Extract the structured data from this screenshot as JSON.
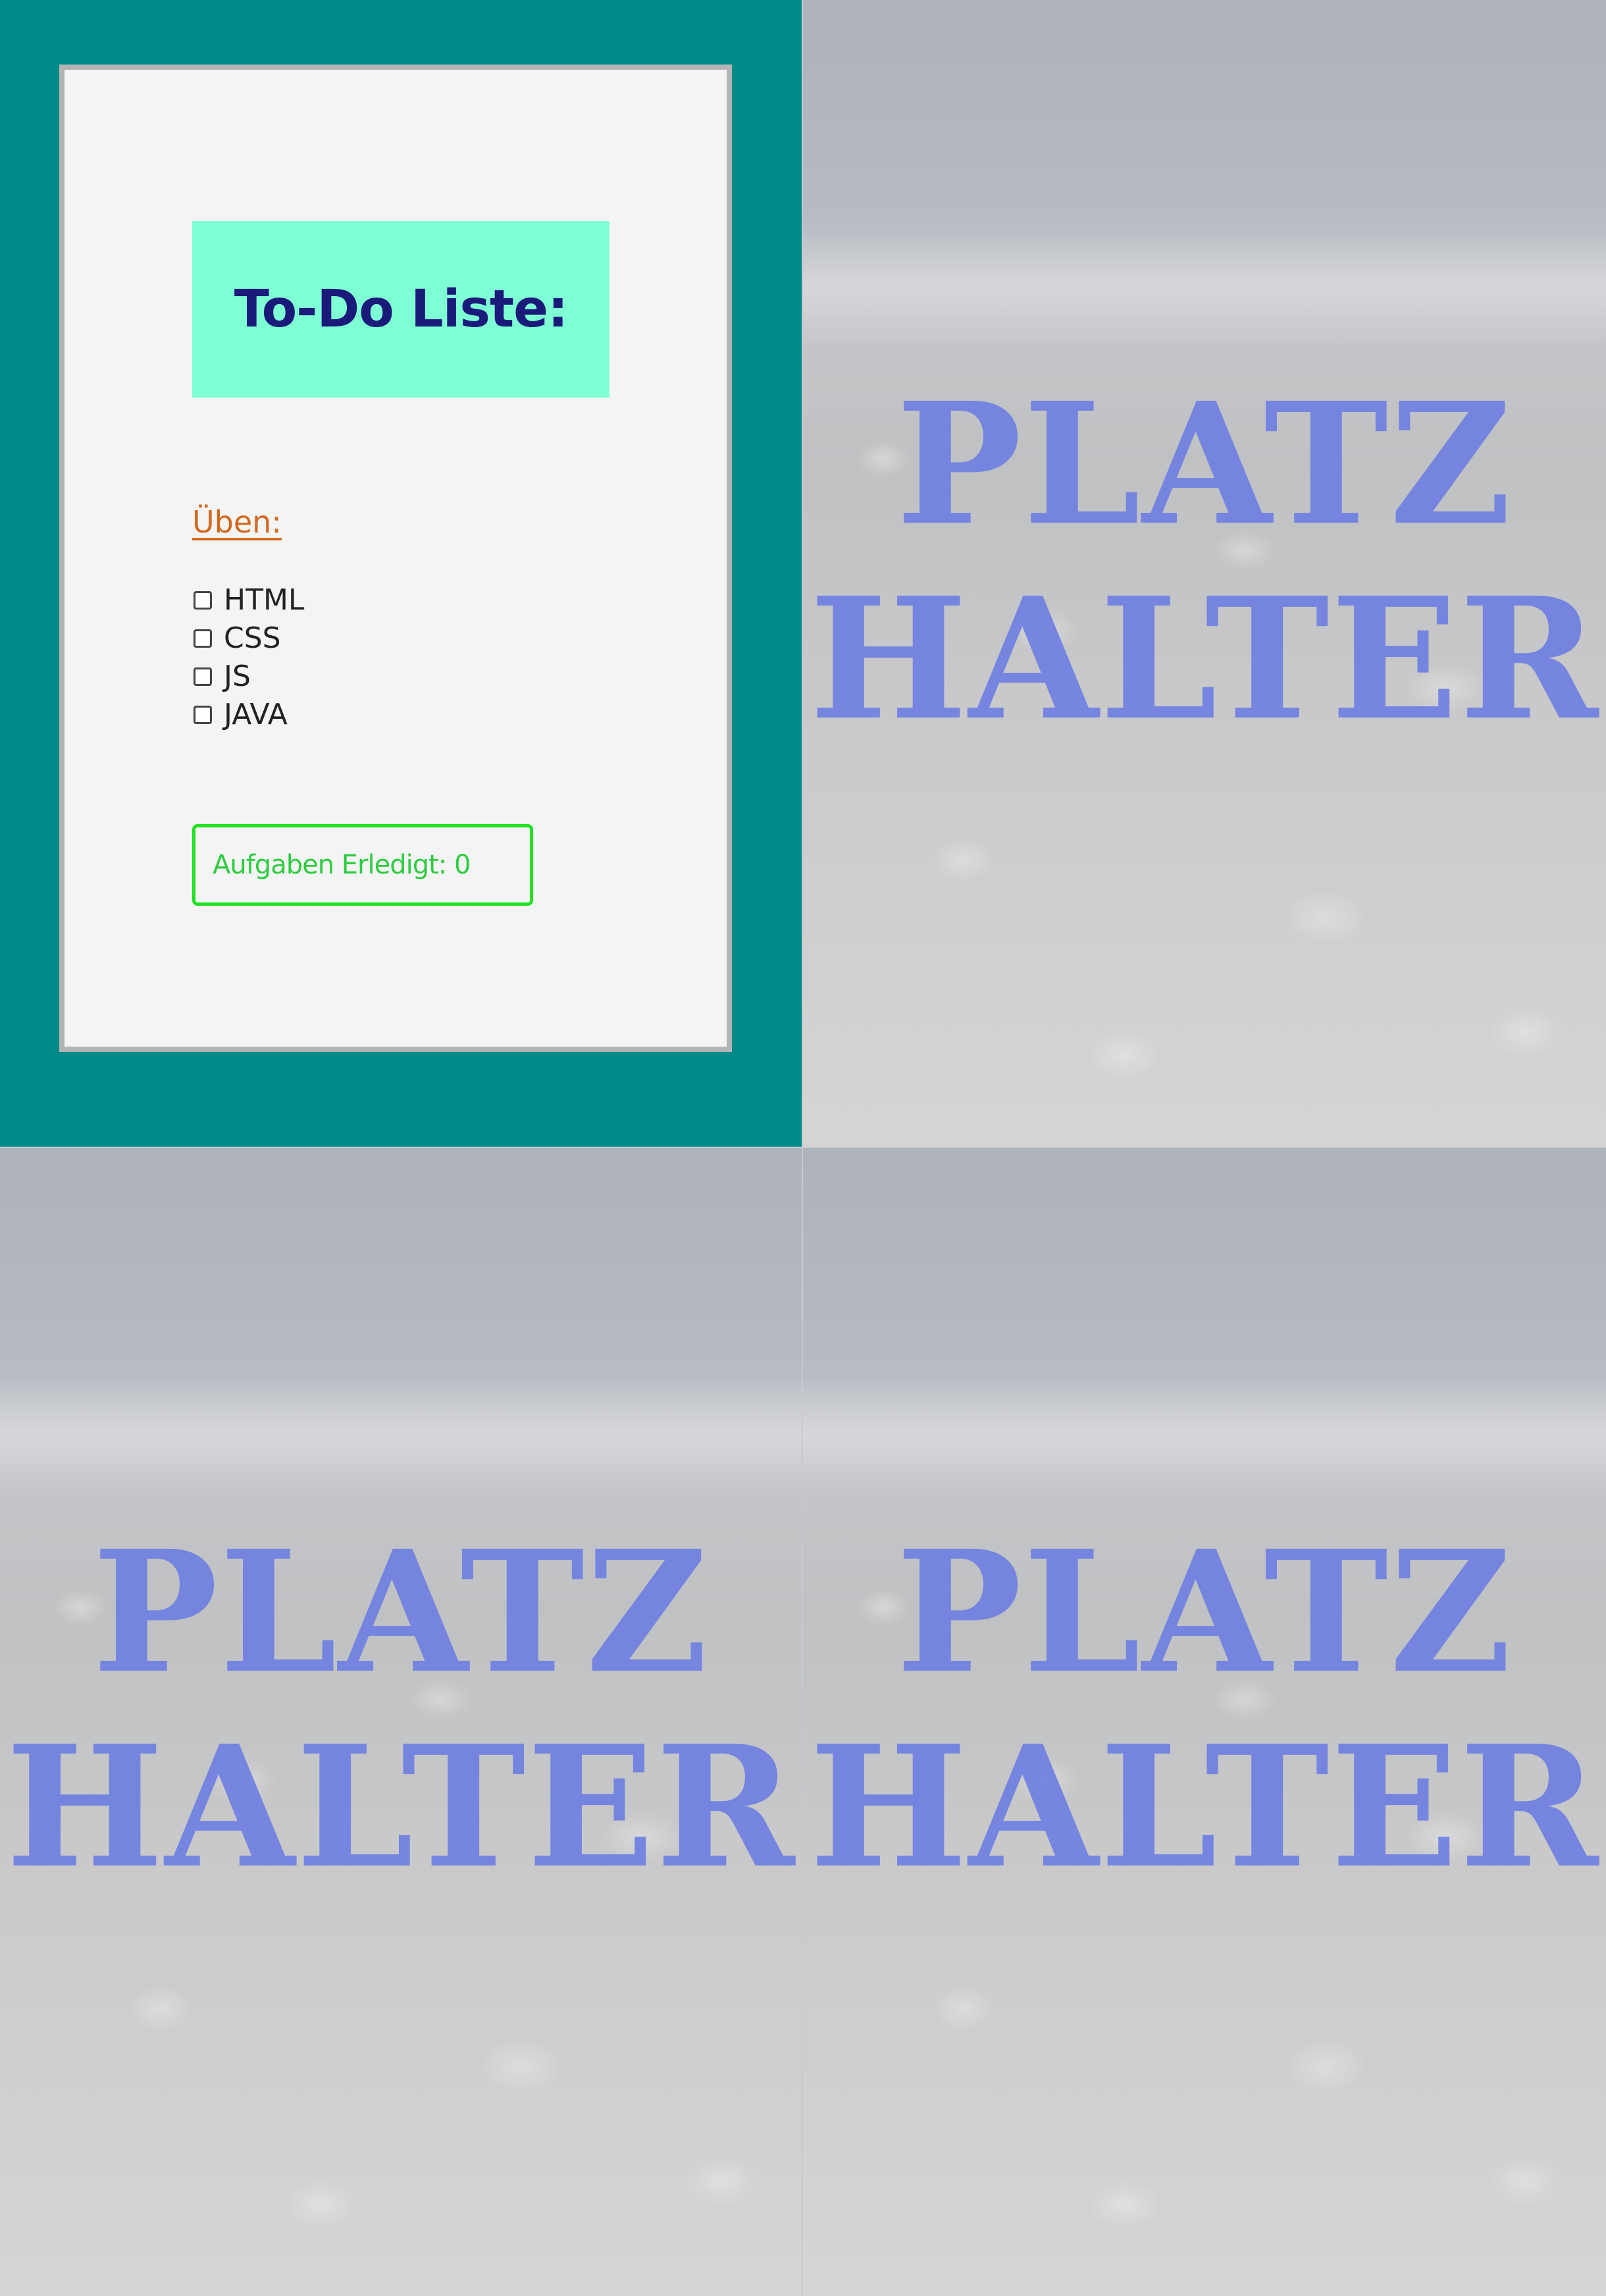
{
  "todo": {
    "title": "To-Do Liste:",
    "section_label": "Üben:",
    "tasks": [
      {
        "label": "HTML",
        "checked": false
      },
      {
        "label": "CSS",
        "checked": false
      },
      {
        "label": "JS",
        "checked": false
      },
      {
        "label": "JAVA",
        "checked": false
      }
    ],
    "status_label": "Aufgaben Erledigt:",
    "done_count": "0"
  },
  "placeholders": [
    {
      "line1": "PLATZ",
      "line2": "HALTER"
    },
    {
      "line1": "PLATZ",
      "line2": "HALTER"
    },
    {
      "line1": "PLATZ",
      "line2": "HALTER"
    }
  ],
  "colors": {
    "panel_bg": "#008b8b",
    "card_bg": "#f4f4f4",
    "title_bg": "#7fffd4",
    "title_text": "#1a1a7a",
    "section_label": "#d2691e",
    "status_border": "#22e022",
    "status_text": "#2ecc40",
    "placeholder_text": "#6f80e2"
  }
}
